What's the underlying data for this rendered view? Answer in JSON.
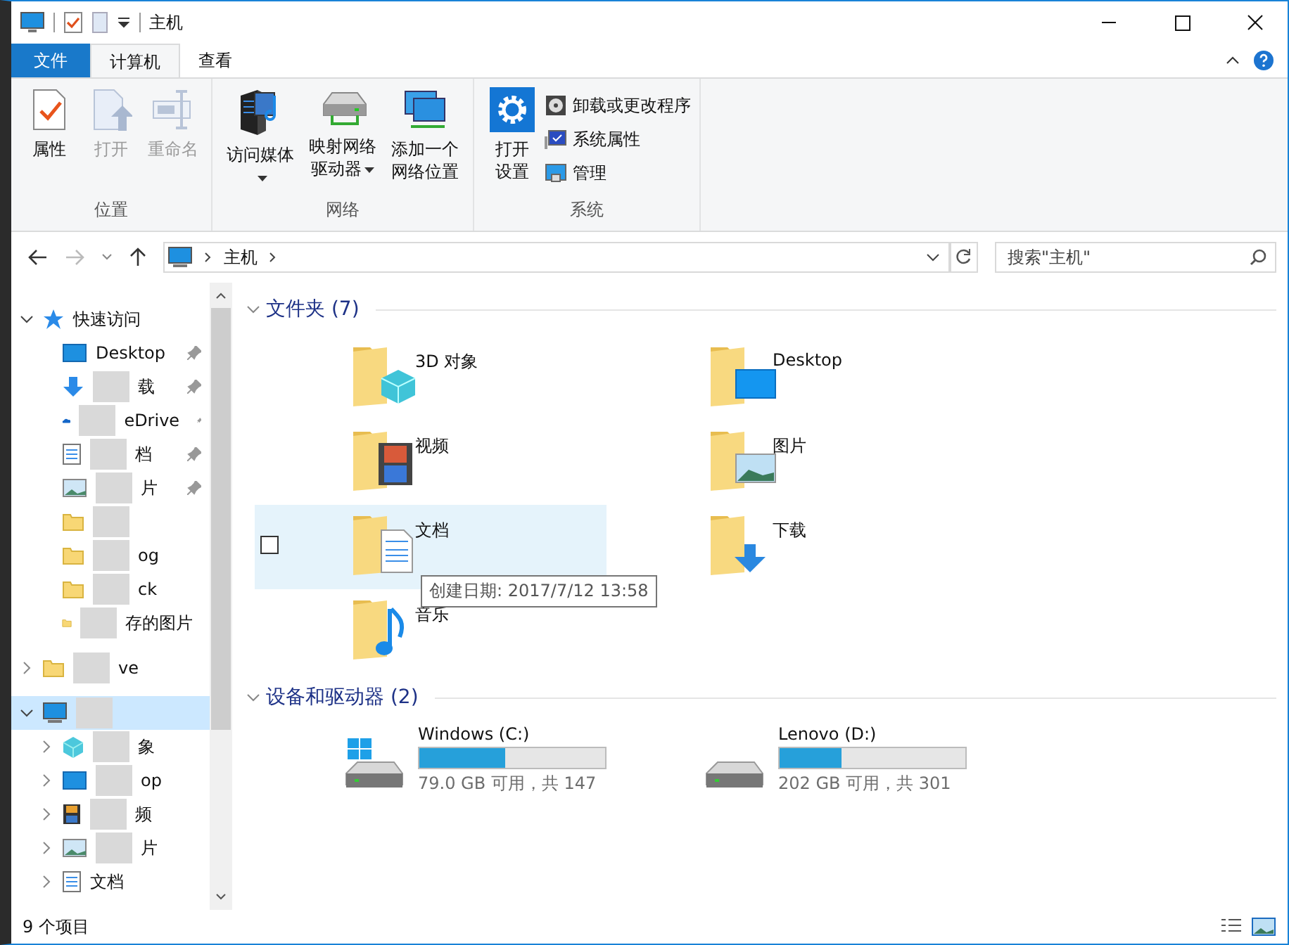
{
  "window": {
    "title": "主机"
  },
  "ribbon_tabs": [
    {
      "label": "文件",
      "kind": "file",
      "selected": false
    },
    {
      "label": "计算机",
      "kind": "tab",
      "selected": true
    },
    {
      "label": "查看",
      "kind": "tab",
      "selected": false
    }
  ],
  "ribbon_groups": [
    {
      "label": "位置",
      "buttons": [
        {
          "kind": "properties",
          "label": "属性",
          "disabled": false
        },
        {
          "kind": "open",
          "label": "打开",
          "disabled": true
        },
        {
          "kind": "rename",
          "label": "重命名",
          "disabled": true
        }
      ]
    },
    {
      "label": "网络",
      "buttons": [
        {
          "kind": "media",
          "label": "访问媒体",
          "dropdown": true,
          "disabled": false
        },
        {
          "kind": "mapdrive",
          "label": "映射网络驱动器",
          "dropdown": true,
          "disabled": false
        },
        {
          "kind": "addnet",
          "label": "添加一个网络位置",
          "disabled": false
        }
      ]
    },
    {
      "label": "系统",
      "buttons": [
        {
          "kind": "settings",
          "label": "打开设置",
          "disabled": false
        }
      ],
      "small_buttons": [
        {
          "kind": "uninstall",
          "label": "卸载或更改程序"
        },
        {
          "kind": "sysprops",
          "label": "系统属性"
        },
        {
          "kind": "manage",
          "label": "管理"
        }
      ]
    }
  ],
  "address": {
    "path": "主机",
    "search_placeholder": "搜索\"主机\""
  },
  "nav_tree": [
    {
      "label": "快速访问",
      "kind": "star",
      "expanded": true,
      "selected": false,
      "children": [
        {
          "label": "Desktop",
          "kind": "desktop",
          "pinned": true
        },
        {
          "label": "载",
          "kind": "download",
          "pinned": true,
          "obscured": true
        },
        {
          "label": "eDrive",
          "kind": "cloud",
          "pinned": true,
          "obscured": true
        },
        {
          "label": "档",
          "kind": "doc",
          "pinned": true,
          "obscured": true
        },
        {
          "label": "片",
          "kind": "picture",
          "pinned": true,
          "obscured": true
        },
        {
          "kind": "folder",
          "pinned": false,
          "obscured": true
        },
        {
          "label": "og",
          "kind": "folder",
          "pinned": false,
          "obscured": true
        },
        {
          "label": "ck",
          "kind": "folder",
          "pinned": false,
          "obscured": true
        },
        {
          "label": "存的图片",
          "kind": "folder",
          "pinned": false,
          "obscured": true
        }
      ]
    },
    {
      "label": "ve",
      "kind": "folder",
      "expanded": false,
      "selected": false,
      "obscured": true
    },
    {
      "kind": "pc",
      "expanded": true,
      "selected": true,
      "obscured": true,
      "children": [
        {
          "label": "象",
          "kind": "cube",
          "expanded": false,
          "obscured": true
        },
        {
          "label": "op",
          "kind": "desktop",
          "expanded": false,
          "obscured": true
        },
        {
          "label": "频",
          "kind": "film",
          "expanded": false,
          "obscured": true
        },
        {
          "label": "片",
          "kind": "picture",
          "expanded": false,
          "obscured": true
        },
        {
          "label": "文档",
          "kind": "doc",
          "expanded": false
        }
      ]
    }
  ],
  "folders": {
    "heading": "文件夹 (7)",
    "expanded": true,
    "items": [
      {
        "name": "3D 对象",
        "kind": "cube",
        "highlighted": false
      },
      {
        "name": "Desktop",
        "kind": "desktop",
        "highlighted": false
      },
      {
        "name": "视频",
        "kind": "film",
        "highlighted": false
      },
      {
        "name": "图片",
        "kind": "picture",
        "highlighted": false
      },
      {
        "name": "文档",
        "kind": "doc",
        "highlighted": true,
        "checked": false
      },
      {
        "name": "下载",
        "kind": "download",
        "highlighted": false
      },
      {
        "name": "音乐",
        "kind": "music",
        "highlighted": false
      }
    ]
  },
  "tooltip": "创建日期: 2017/7/12 13:58",
  "drives": {
    "heading": "设备和驱动器 (2)",
    "expanded": true,
    "items": [
      {
        "name": "Windows (C:)",
        "kind": "system",
        "level": 0.46,
        "free": "79.0 GB 可用，共 147"
      },
      {
        "name": "Lenovo (D:)",
        "kind": "data",
        "level": 0.33,
        "free": "202 GB 可用，共 301"
      }
    ]
  },
  "status_bar": {
    "count": "9 个项目"
  }
}
